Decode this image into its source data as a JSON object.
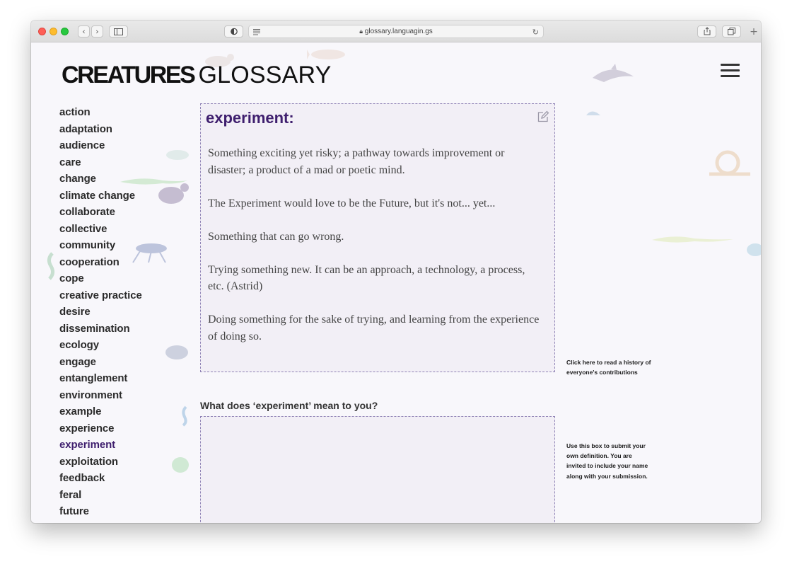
{
  "browser": {
    "url": "glossary.languagin.gs"
  },
  "header": {
    "logo_bold": "CREATURES",
    "logo_light": "GLOSSARY"
  },
  "sidebar": {
    "terms": [
      "action",
      "adaptation",
      "audience",
      "care",
      "change",
      "climate change",
      "collaborate",
      "collective",
      "community",
      "cooperation",
      "cope",
      "creative practice",
      "desire",
      "dissemination",
      "ecology",
      "engage",
      "entanglement",
      "environment",
      "example",
      "experience",
      "experiment",
      "exploitation",
      "feedback",
      "feral",
      "future"
    ],
    "active_term": "experiment"
  },
  "definition": {
    "title": "experiment:",
    "entries": [
      "Something exciting yet risky; a pathway towards improvement or disaster; a product of a mad or poetic mind.",
      "The Experiment would love to be the Future, but it's not... yet...",
      "Something that can go wrong.",
      "Trying something new. It can be an approach, a technology, a process, etc. (Astrid)",
      "Doing something for the sake of trying, and learning from the experience of doing so."
    ]
  },
  "history_note": "Click here to read a history of everyone's contributions",
  "submission": {
    "question": "What does ‘experiment’ mean to you?",
    "note": "Use this box to submit your own definition. You are invited to include your name along with your submission.",
    "value": ""
  },
  "colors": {
    "accent": "#3f1f6e",
    "box_bg": "#f2eff6",
    "box_border": "#8f82b5"
  }
}
